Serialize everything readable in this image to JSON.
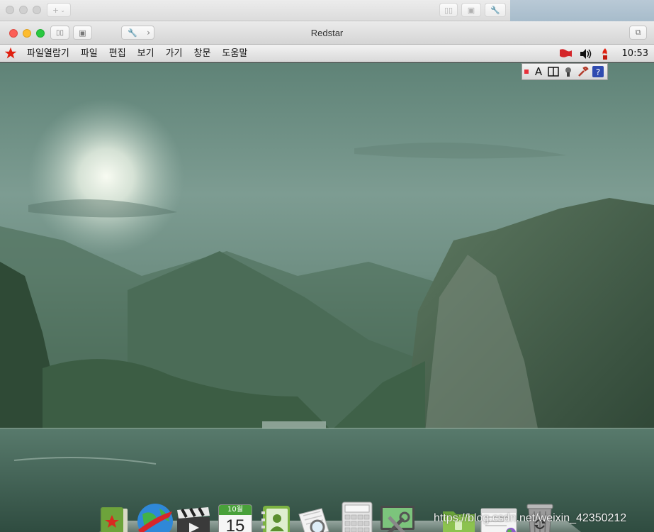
{
  "vm_window": {
    "title": "Redstar"
  },
  "guest_menubar": {
    "items": [
      "파일열람기",
      "파일",
      "편집",
      "보기",
      "가기",
      "창문",
      "도움말"
    ],
    "clock": "10:53"
  },
  "ime_toolbar": {
    "letter": "A"
  },
  "dock": {
    "calendar": {
      "month": "10월",
      "day": "15"
    }
  },
  "watermark": "https://blog.csdn.net/weixin_42350212",
  "colors": {
    "star": "#e02010",
    "flag": "#d4262a",
    "menubar": "#e4e4e4"
  }
}
